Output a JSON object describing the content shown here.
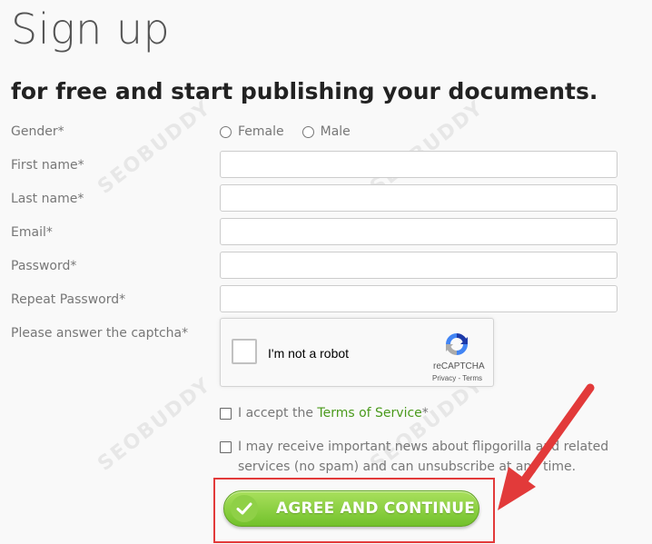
{
  "page": {
    "title": "Sign up",
    "subtitle": "for free and start publishing your documents."
  },
  "form": {
    "gender_label": "Gender*",
    "gender_options": [
      "Female",
      "Male"
    ],
    "first_name_label": "First name*",
    "last_name_label": "Last name*",
    "email_label": "Email*",
    "password_label": "Password*",
    "repeat_password_label": "Repeat Password*",
    "captcha_label": "Please answer the captcha*",
    "first_name_value": "",
    "last_name_value": "",
    "email_value": "",
    "password_value": "",
    "repeat_password_value": ""
  },
  "captcha": {
    "checkbox_text": "I'm not a robot",
    "brand": "reCAPTCHA",
    "privacy": "Privacy",
    "separator": " - ",
    "terms": "Terms"
  },
  "terms_check": {
    "prefix": "I accept the ",
    "link": "Terms of Service",
    "suffix": "*"
  },
  "news_check": {
    "line1": "I may receive important news about flipgorilla and related",
    "line2": "services (no spam) and can unsubscribe at any time."
  },
  "cta": {
    "label": "AGREE AND CONTINUE"
  },
  "watermark": "SEOBUDDY",
  "colors": {
    "accent_green": "#72c12b",
    "link_green": "#4a9a1c",
    "annotation_red": "#e23a3a"
  }
}
